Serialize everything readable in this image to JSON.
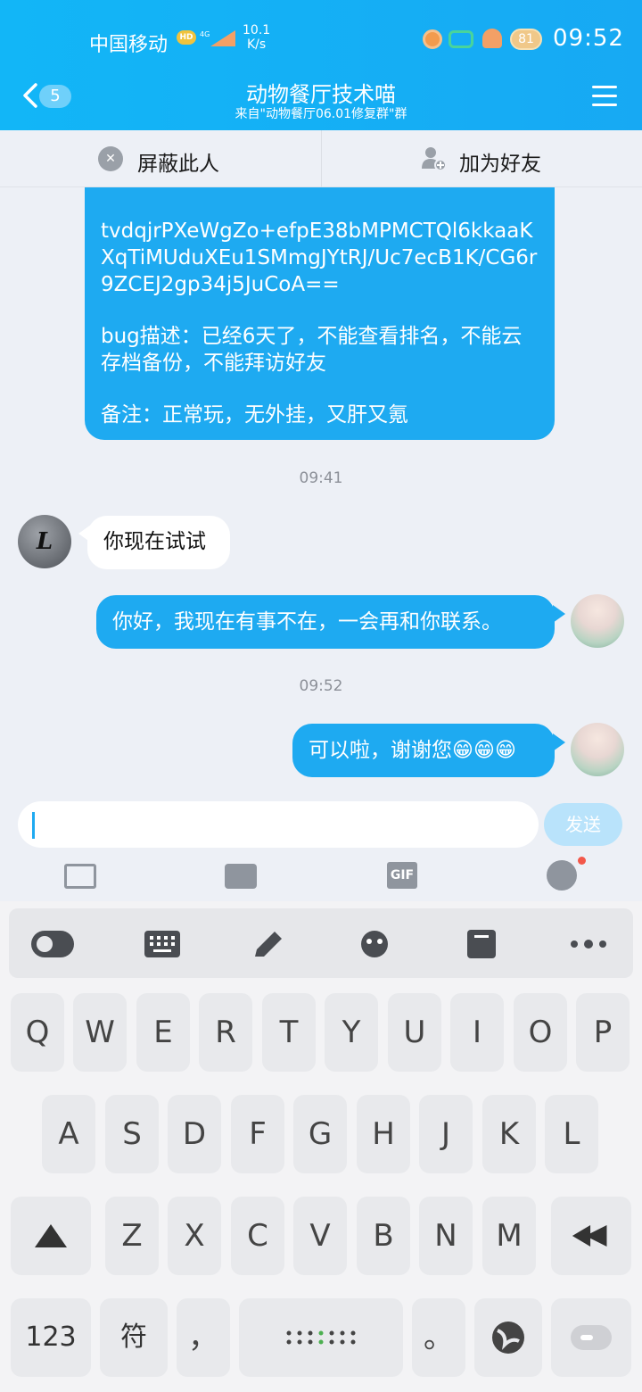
{
  "status_bar": {
    "carrier": "中国移动",
    "hd": "HD",
    "network": "4G",
    "speed_value": "10.1",
    "speed_unit": "K/s",
    "battery": "81",
    "time": "09:52"
  },
  "header": {
    "unread_count": "5",
    "title": "动物餐厅技术喵",
    "subtitle": "来自\"动物餐厅06.01修复群\"群"
  },
  "actions": {
    "block_label": "屏蔽此人",
    "add_friend_label": "加为好友"
  },
  "messages": {
    "m1": {
      "token": "tvdqjrPXeWgZo+efpE38bMPMCTQl6kkaaKXqTiMUduXEu1SMmgJYtRJ/Uc7ecB1K/CG6r9ZCEJ2gp34j5JuCoA==",
      "bug": "bug描述：已经6天了，不能查看排名，不能云存档备份，不能拜访好友",
      "note": "备注：正常玩，无外挂，又肝又氪"
    },
    "t1": "09:41",
    "m2": "你现在试试",
    "avatar_letter": "L",
    "m3": "你好，我现在有事不在，一会再和你联系。",
    "t2": "09:52",
    "m4": "可以啦，谢谢您😁😁😁"
  },
  "input": {
    "value": "",
    "send_label": "发送",
    "gif_label": "GIF"
  },
  "keyboard": {
    "row1": [
      "Q",
      "W",
      "E",
      "R",
      "T",
      "Y",
      "U",
      "I",
      "O",
      "P"
    ],
    "row2": [
      "A",
      "S",
      "D",
      "F",
      "G",
      "H",
      "J",
      "K",
      "L"
    ],
    "row3": [
      "Z",
      "X",
      "C",
      "V",
      "B",
      "N",
      "M"
    ],
    "num_label": "123",
    "sym_label": "符",
    "comma": "，",
    "period": "。"
  },
  "colors": {
    "header_blue": "#17a9f3",
    "bubble_blue": "#1eaaf1",
    "background": "#edf0f6"
  }
}
